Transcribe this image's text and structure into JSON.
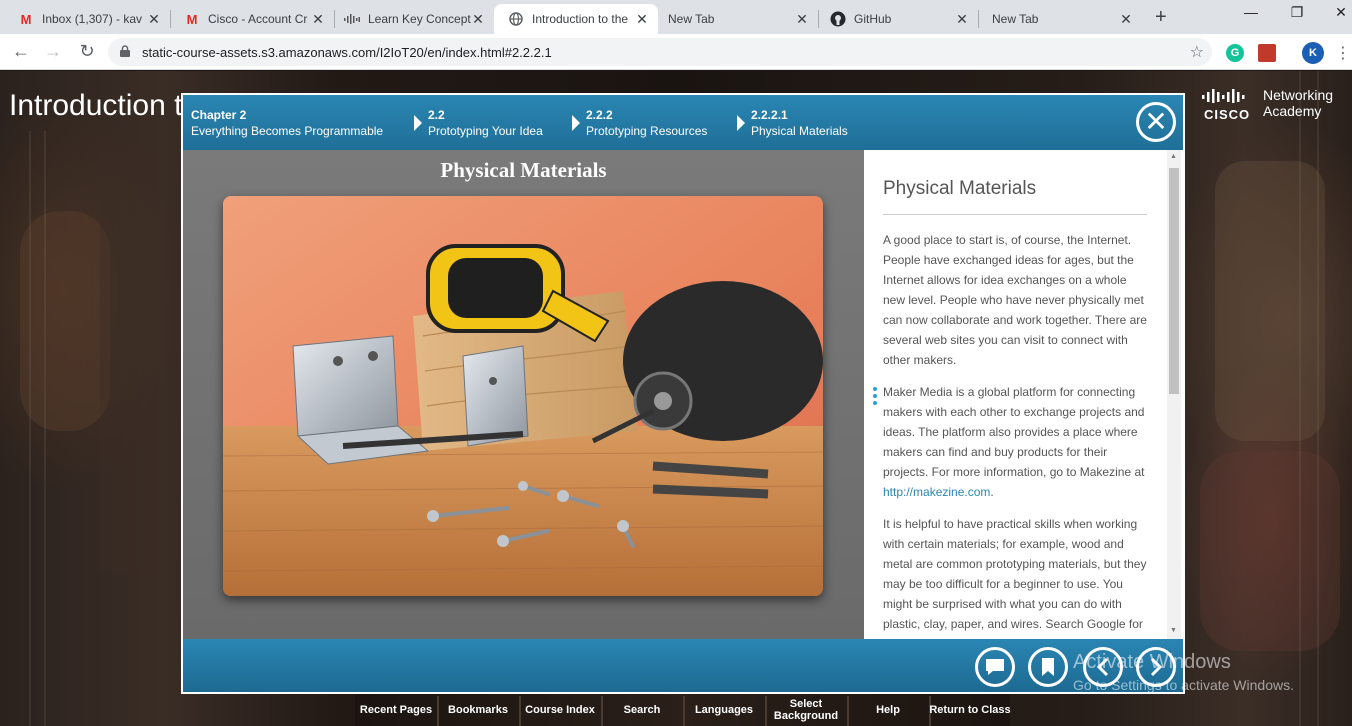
{
  "browser": {
    "tabs": [
      {
        "title": "Inbox (1,307) - kav",
        "icon": "gmail-icon"
      },
      {
        "title": "Cisco - Account Cr",
        "icon": "gmail-icon"
      },
      {
        "title": "Learn Key Concept",
        "icon": "cisco-icon"
      },
      {
        "title": "Introduction to the",
        "icon": "globe-icon",
        "active": true
      },
      {
        "title": "New Tab",
        "icon": ""
      },
      {
        "title": "GitHub",
        "icon": "github-icon"
      },
      {
        "title": "New Tab",
        "icon": ""
      }
    ],
    "new_tab": "+",
    "url": "static-course-assets.s3.amazonaws.com/I2IoT20/en/index.html#2.2.2.1",
    "profile_initial": "K",
    "extension_g": "G",
    "window_controls": {
      "minimize": "—",
      "maximize": "❐",
      "close": "✕"
    }
  },
  "page": {
    "bg_title": "Introduction t",
    "brand": {
      "line1": "Networking",
      "line2": "Academy",
      "wordmark": "CISCO"
    }
  },
  "course": {
    "breadcrumbs": [
      {
        "num": "Chapter 2",
        "label": "Everything Becomes Programmable"
      },
      {
        "num": "2.2",
        "label": "Prototyping Your Idea"
      },
      {
        "num": "2.2.2",
        "label": "Prototyping Resources"
      },
      {
        "num": "2.2.2.1",
        "label": "Physical Materials"
      }
    ],
    "close": "✕",
    "media_title": "Physical Materials",
    "text_title": "Physical Materials",
    "paragraphs": [
      "A good place to start is, of course, the Internet. People have exchanged ideas for ages, but the Internet allows for idea exchanges on a whole new level. People who have never physically met can now collaborate and work together. There are several web sites you can visit to connect with other makers.",
      "Maker Media is a global platform for connecting makers with each other to exchange projects and ideas. The platform also provides a place where makers can find and buy products for their projects. For more information, go to Makezine at",
      "It is helpful to have practical skills when working with certain materials; for example, wood and metal are common prototyping materials, but they may be too difficult for a beginner to use. You might be surprised with what you can do with plastic, clay, paper, and wires. Search Google for more information and tutorials."
    ],
    "link": "http://makezine.com",
    "link_after": "."
  },
  "watermark": {
    "line1": "Activate Windows",
    "line2": "Go to Settings to activate Windows."
  },
  "menu": [
    "Recent Pages",
    "Bookmarks",
    "Course Index",
    "Search",
    "Languages",
    "Select Background",
    "Help",
    "Return to Class"
  ]
}
